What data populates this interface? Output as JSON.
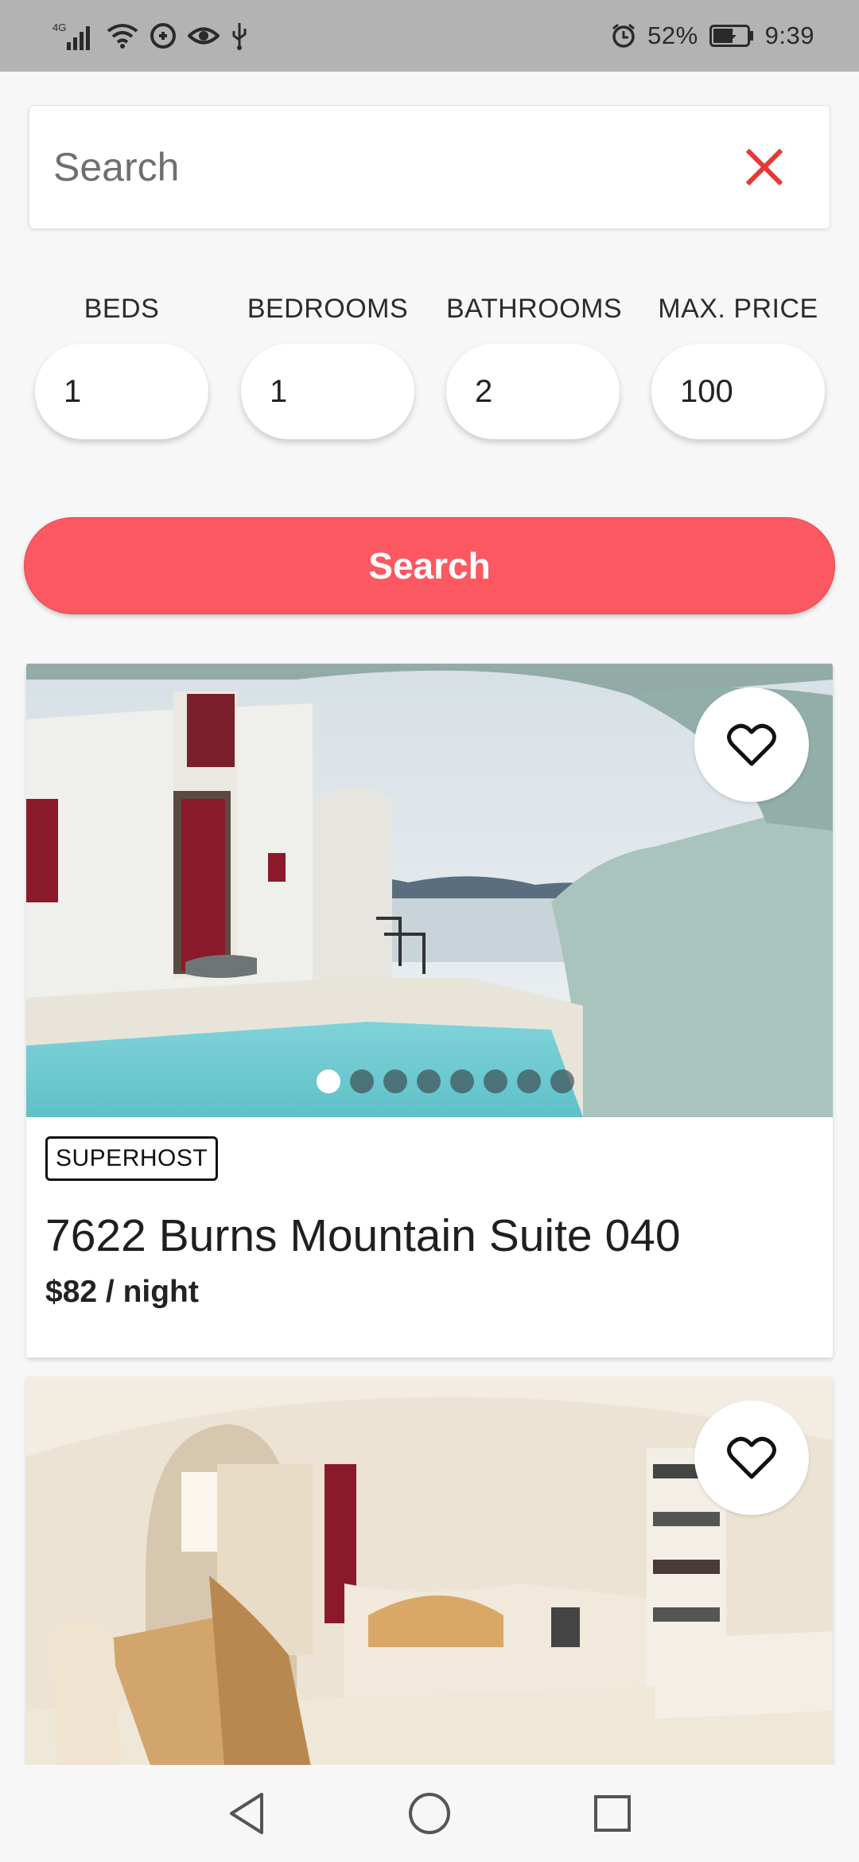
{
  "status_bar": {
    "network": "4G",
    "battery": "52%",
    "time": "9:39"
  },
  "search": {
    "placeholder": "Search",
    "value": "",
    "clear_icon": "close-icon",
    "clear_color": "#e53935"
  },
  "filters": [
    {
      "label": "BEDS",
      "value": "1"
    },
    {
      "label": "BEDROOMS",
      "value": "1"
    },
    {
      "label": "BATHROOMS",
      "value": "2"
    },
    {
      "label": "MAX. PRICE",
      "value": "100"
    }
  ],
  "search_button": {
    "label": "Search",
    "color": "#fc5861"
  },
  "listings": [
    {
      "badge": "SUPERHOST",
      "title": "7622 Burns Mountain Suite 040",
      "price": "$82 / night",
      "photo_count": 8,
      "active_photo": 1,
      "favorite_icon": "heart-outline-icon"
    },
    {
      "favorite_icon": "heart-outline-icon"
    }
  ],
  "nav_bar": {
    "back_icon": "back-triangle-icon",
    "home_icon": "home-circle-icon",
    "recents_icon": "recents-square-icon"
  }
}
